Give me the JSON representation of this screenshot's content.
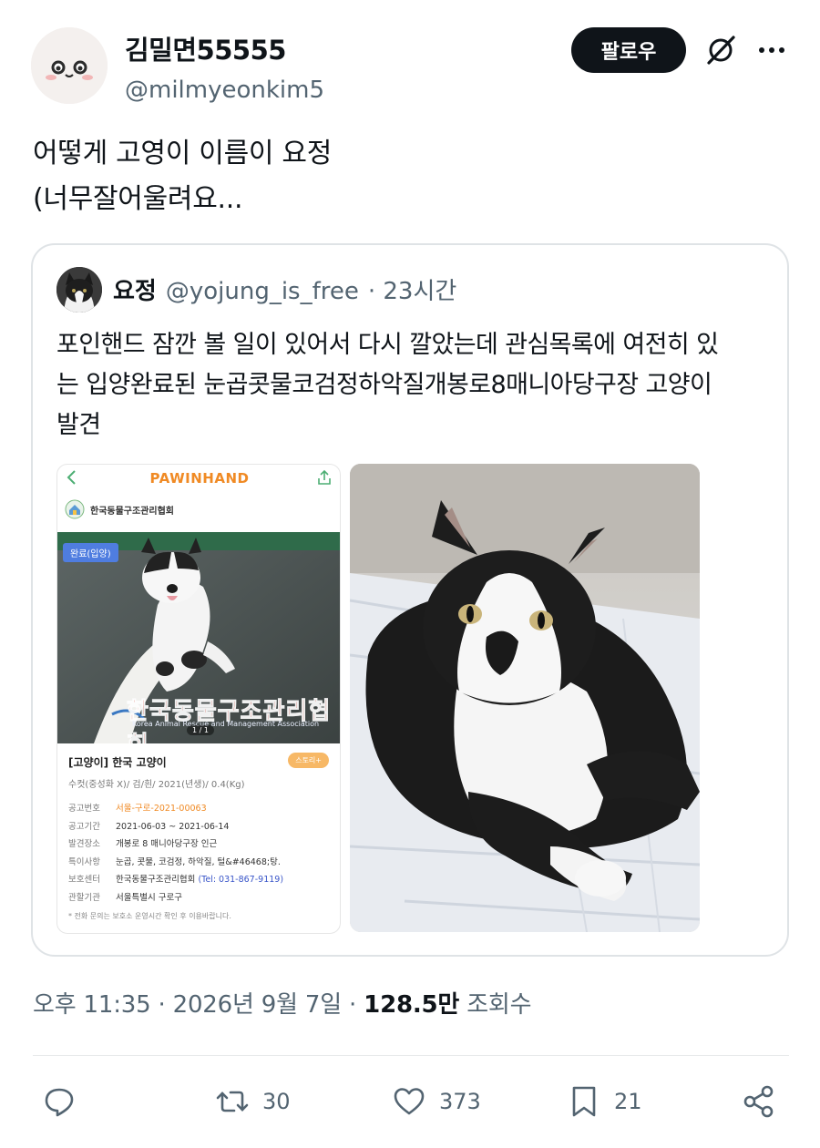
{
  "author": {
    "display_name": "김밀면55555",
    "handle": "@milmyeonkim5",
    "follow_label": "팔로우"
  },
  "tweet": {
    "lines": [
      "어떻게 고영이 이름이 요정",
      "(너무잘어울려요..."
    ]
  },
  "quote": {
    "name": "요정",
    "handle": "@yojung_is_free",
    "time": "· 23시간",
    "lines": [
      "포인핸드 잠깐 볼 일이 있어서 다시 깔았는데 관심목록에 여전히 있",
      "는 입양완료된 눈곱콧물코검정하악질개봉로8매니아당구장 고양이",
      "발견"
    ],
    "screenshot": {
      "app_title": "PAWINHAND",
      "org_name": "한국동물구조관리협회",
      "badge": "완료(입양)",
      "page_indicator": "1 / 1",
      "watermark": "한국동물구조관리협회",
      "watermark_sub": "Korea Animal Rescue and Management Association",
      "title": "[고양이] 한국 고양이",
      "story_button": "스토리+",
      "subtitle": "수컷(중성화 X)/ 검/흰/ 2021(년생)/ 0.4(Kg)",
      "rows": [
        {
          "key": "공고번호",
          "value": "서울-구로-2021-00063"
        },
        {
          "key": "공고기간",
          "value": "2021-06-03 ~ 2021-06-14"
        },
        {
          "key": "발견장소",
          "value": "개봉로 8 매니아당구장 인근"
        },
        {
          "key": "특이사항",
          "value": "눈곱, 콧물, 코검정, 하악질, 털&#46468;탕."
        },
        {
          "key": "보호센터",
          "value": "한국동물구조관리협회",
          "tel": "(Tel: 031-867-9119)"
        },
        {
          "key": "관할기관",
          "value": "서울특별시 구로구"
        }
      ],
      "footnote": "* 전화 문의는 보호소 운영시간 확인 후 이용바랍니다."
    }
  },
  "meta": {
    "time": "오후 11:35 · 2026년 9월 7일 · ",
    "views": "128.5만",
    "views_label": " 조회수"
  },
  "actions": {
    "reply_icon": "reply-icon",
    "retweet_count": "30",
    "like_count": "373",
    "bookmark_count": "21",
    "share_icon": "share-icon"
  },
  "colors": {
    "follow_bg": "#0f1419",
    "secondary_text": "#536471",
    "pawinhand_orange": "#f08a24",
    "badge_blue": "#4f7de0"
  }
}
